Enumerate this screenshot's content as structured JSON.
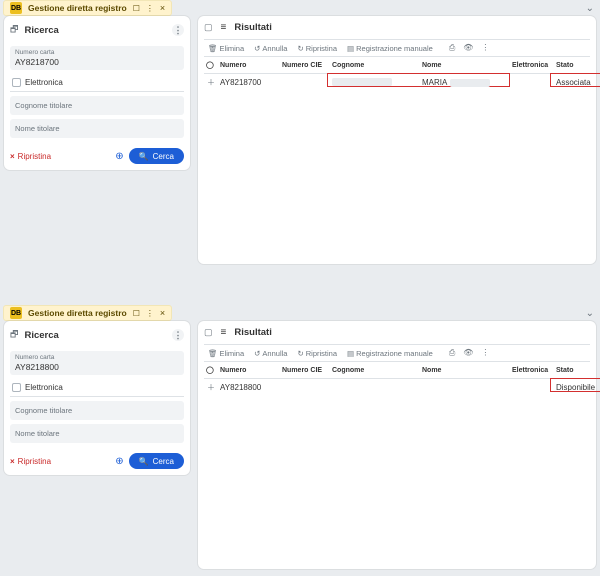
{
  "instances": {
    "a": {
      "title": "Gestione diretta registro",
      "badge": "DB",
      "search": {
        "title": "Ricerca",
        "numero_label": "Numero carta",
        "numero_value": "AY8218700",
        "elettronica_label": "Elettronica",
        "cognome_placeholder": "Cognome titolare",
        "nome_placeholder": "Nome titolare",
        "reset_label": "Ripristina",
        "search_label": "Cerca"
      },
      "results": {
        "title": "Risultati",
        "toolbar": {
          "elimina": "Elimina",
          "annulla": "Annulla",
          "ripristina": "Ripristina",
          "registrazione": "Registrazione manuale"
        },
        "cols": {
          "numero": "Numero",
          "cie": "Numero CIE",
          "cognome": "Cognome",
          "nome": "Nome",
          "elettronica": "Elettronica",
          "stato": "Stato"
        },
        "row": {
          "numero": "AY8218700",
          "nome": "MARIA",
          "stato": "Associata"
        }
      }
    },
    "b": {
      "title": "Gestione diretta registro",
      "badge": "DB",
      "search": {
        "title": "Ricerca",
        "numero_label": "Numero carta",
        "numero_value": "AY8218800",
        "elettronica_label": "Elettronica",
        "cognome_placeholder": "Cognome titolare",
        "nome_placeholder": "Nome titolare",
        "reset_label": "Ripristina",
        "search_label": "Cerca"
      },
      "results": {
        "title": "Risultati",
        "toolbar": {
          "elimina": "Elimina",
          "annulla": "Annulla",
          "ripristina": "Ripristina",
          "registrazione": "Registrazione manuale"
        },
        "cols": {
          "numero": "Numero",
          "cie": "Numero CIE",
          "cognome": "Cognome",
          "nome": "Nome",
          "elettronica": "Elettronica",
          "stato": "Stato"
        },
        "row": {
          "numero": "AY8218800",
          "stato": "Disponibile"
        }
      }
    }
  }
}
